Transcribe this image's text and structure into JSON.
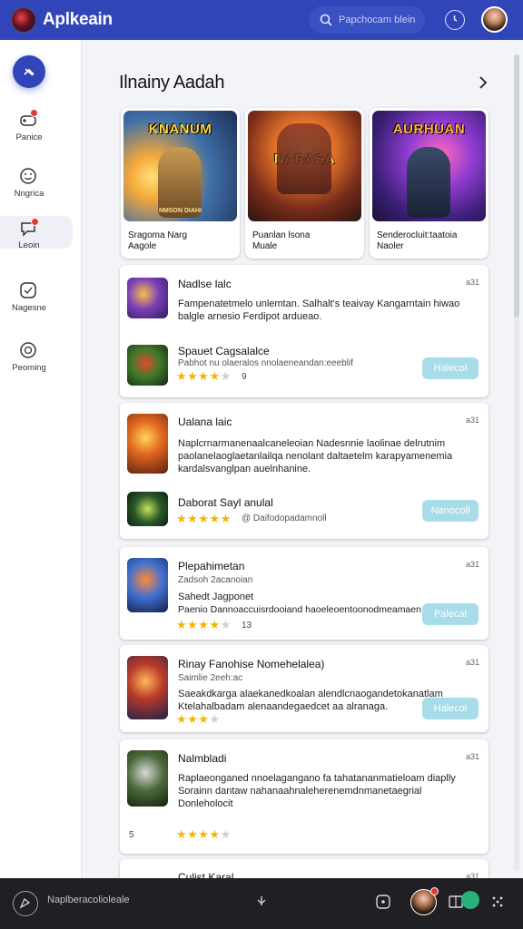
{
  "topbar": {
    "app_title": "Aplkeain",
    "search_placeholder": "Papchocam blein",
    "logo_icon": "game-logo-icon",
    "bg_color": "#2f45b8"
  },
  "sidebar": {
    "items": [
      {
        "label": "Panice",
        "icon": "controller-icon",
        "badge": true
      },
      {
        "label": "Nngrica",
        "icon": "smiley-icon",
        "badge": false
      },
      {
        "label": "Leoin",
        "icon": "chat-icon",
        "badge": true,
        "active": true
      },
      {
        "label": "Nagesne",
        "icon": "message-icon",
        "badge": false
      },
      {
        "label": "Peoming",
        "icon": "circle-icon",
        "badge": false
      }
    ]
  },
  "featured": {
    "title": "Ilnainy Aadah",
    "cards": [
      {
        "art_logo": "KNANUM",
        "art_tag": "NMSON DIAHI",
        "caption_line1": "Sragoma Narg",
        "caption_line2": "Aagole"
      },
      {
        "art_logo": "NARASA",
        "art_tag": "",
        "caption_line1": "Puanlan lsona",
        "caption_line2": "Muale"
      },
      {
        "art_logo": "AURHUAN",
        "art_tag": "",
        "caption_line1": "Senderocluit:taatoia",
        "caption_line2": "Naoler"
      }
    ]
  },
  "list": [
    {
      "meta": "a31",
      "title": "Nadlse lalc",
      "desc1": "Fampenatetmelo unlemtan. Salhalt's teaivay Kangarntain hiwao",
      "desc2": "balgle arnesio Ferdipot ardueao.",
      "sub_title": "Spauet Cagsalalce",
      "sub_meta": "Pabhot nu olaeralos nnolaeneandan:eeeblif",
      "stars": 4,
      "rating": "9",
      "button": "Halecol"
    },
    {
      "meta": "a31",
      "title": "Ualana laic",
      "desc1": "Naplcrnarmanenaalcaneleoian Nadesnnie laolinae delrutnim",
      "desc2": "paolanelaoglaetanlailqa nenolant daltaetelm karapyamenemia",
      "desc3": "kardalsvanglpan auelnhanine.",
      "sub_title": "Daborat Sayl anulal",
      "sub_meta": "@ Daifodopadamnoll",
      "stars": 5,
      "rating": "",
      "button": "Nanocoll"
    },
    {
      "meta": "a31",
      "title": "Plepahimetan",
      "sub1": "Zadsoh 2acanoian",
      "line2": "Sahedt Jagponet",
      "desc1": "Paenio Dannoaccuisrdooiand haoeleoentoonodmeamaen hlaao",
      "stars": 4,
      "rating": "13",
      "button": "Palecal"
    },
    {
      "meta": "a31",
      "title": "Rinay Fanohise Nomehelalea)",
      "sub1": "Saimlie 2eeh:ac",
      "desc1": "Saeakdkarga alaekanedkoalan alendlcnaogandetokanatlam",
      "desc2": "Ktelahalbadam alenaandegaedcet aa alranaga.",
      "stars": 3,
      "rating": "",
      "button": "Halecol"
    },
    {
      "meta": "a31",
      "title": "Nalmbladi",
      "desc1": "Raplaeonganed nnoelagangano fa tahatananmatieloam diaplly",
      "desc2": "Sorainn dantaw nahanaahnaleherenemdnmanetaegrial",
      "desc3": "Donleholocit",
      "stars": 4,
      "rating": "",
      "left_num": "5",
      "button": ""
    },
    {
      "meta": "a31",
      "title": "Culist Karal",
      "button": ""
    }
  ],
  "bottombar": {
    "input_placeholder": "Naplberacolioleale"
  }
}
